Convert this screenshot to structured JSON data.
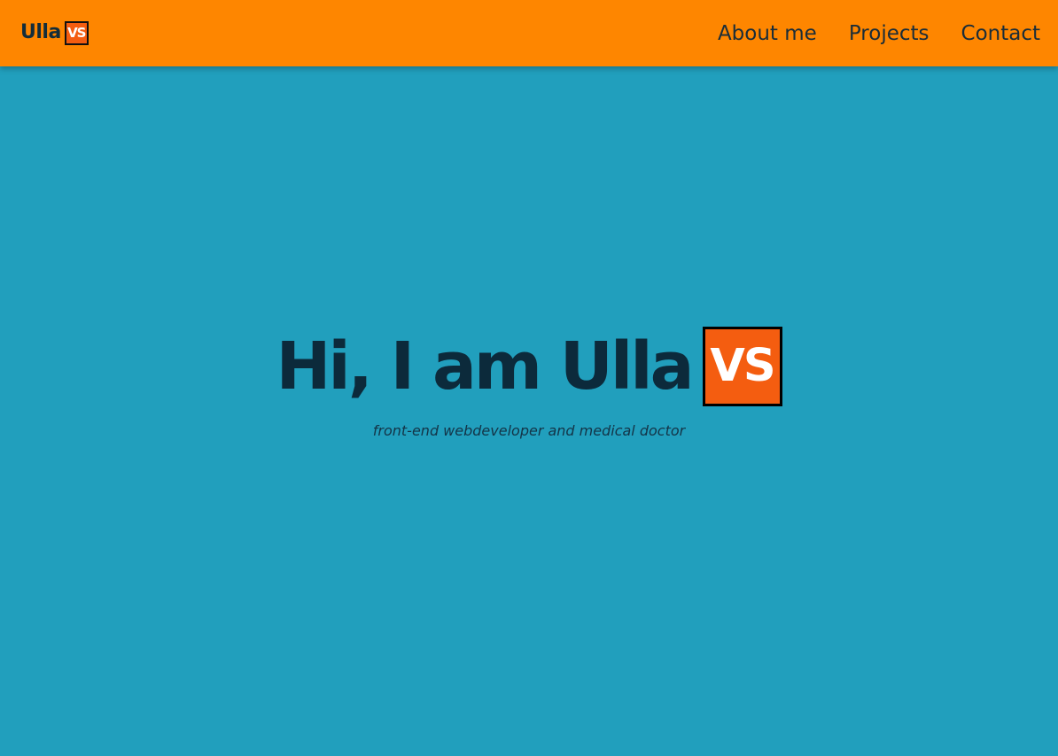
{
  "header": {
    "brand_name": "Ulla",
    "brand_logo_text": "VS",
    "nav": {
      "about": "About me",
      "projects": "Projects",
      "contact": "Contact"
    }
  },
  "hero": {
    "title": "Hi, I am Ulla",
    "logo_text": "VS",
    "subtitle": "front-end webdeveloper and medical doctor"
  },
  "colors": {
    "header_background": "#fe8600",
    "page_background": "#219fbd",
    "logo_background": "#f45d10",
    "text_dark": "#0c2a3b"
  }
}
